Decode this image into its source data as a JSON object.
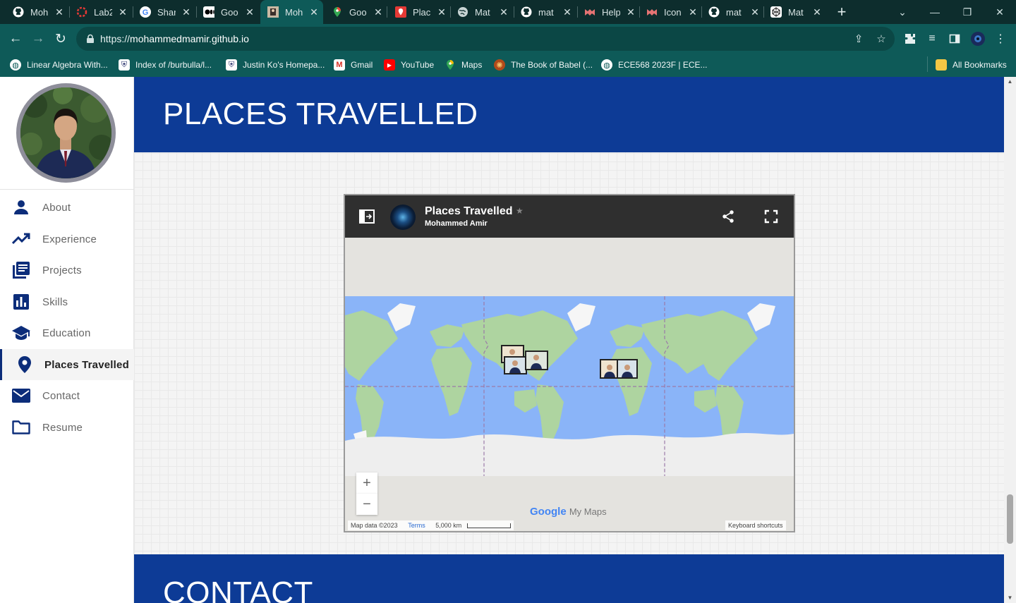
{
  "browser": {
    "tabs": [
      {
        "title": "Moh",
        "icon": "github-icon"
      },
      {
        "title": "Lab2",
        "icon": "circle-dash-icon"
      },
      {
        "title": "Shar",
        "icon": "google-icon"
      },
      {
        "title": "Goo",
        "icon": "medium-icon"
      },
      {
        "title": "Moh",
        "icon": "site-icon",
        "active": true
      },
      {
        "title": "Goo",
        "icon": "maps-icon"
      },
      {
        "title": "Plac",
        "icon": "mymaps-icon"
      },
      {
        "title": "Mat",
        "icon": "globe-icon"
      },
      {
        "title": "mat",
        "icon": "github-icon"
      },
      {
        "title": "Help",
        "icon": "mui-icon"
      },
      {
        "title": "Icon",
        "icon": "mui-icon"
      },
      {
        "title": "mat",
        "icon": "github-icon"
      },
      {
        "title": "Mat",
        "icon": "codepen-icon"
      }
    ],
    "url_prefix": "https://",
    "url_host": "mohammedmamir.github.io",
    "bookmarks": [
      {
        "label": "Linear Algebra With...",
        "icon": "globe-icon"
      },
      {
        "label": "Index of /burbulla/l...",
        "icon": "crest-icon"
      },
      {
        "label": "Justin Ko's Homepa...",
        "icon": "crest-icon"
      },
      {
        "label": "Gmail",
        "icon": "gmail-icon"
      },
      {
        "label": "YouTube",
        "icon": "youtube-icon"
      },
      {
        "label": "Maps",
        "icon": "maps-icon"
      },
      {
        "label": "The Book of Babel (...",
        "icon": "babel-icon"
      },
      {
        "label": "ECE568 2023F | ECE...",
        "icon": "globe-icon"
      }
    ],
    "all_bookmarks": "All Bookmarks"
  },
  "sidebar": {
    "items": [
      {
        "label": "About",
        "icon": "person-icon"
      },
      {
        "label": "Experience",
        "icon": "trending-up-icon"
      },
      {
        "label": "Projects",
        "icon": "library-books-icon"
      },
      {
        "label": "Skills",
        "icon": "bar-chart-icon"
      },
      {
        "label": "Education",
        "icon": "school-icon"
      },
      {
        "label": "Places Travelled",
        "icon": "location-pin-icon",
        "active": true
      },
      {
        "label": "Contact",
        "icon": "mail-icon"
      },
      {
        "label": "Resume",
        "icon": "folder-icon"
      }
    ]
  },
  "main": {
    "section_title": "PLACES TRAVELLED",
    "next_section_title": "CONTACT"
  },
  "map": {
    "title": "Places Travelled",
    "author": "Mohammed Amir",
    "zoom_in": "+",
    "zoom_out": "−",
    "logo_google": "Google",
    "logo_mymaps": "My Maps",
    "map_data": "Map data ©2023",
    "terms": "Terms",
    "scale": "5,000 km",
    "keyboard": "Keyboard shortcuts"
  },
  "colors": {
    "banner": "#0d3b96",
    "accent": "#0c2d7a",
    "ocean": "#8ab4f8",
    "land": "#aed4a0"
  }
}
